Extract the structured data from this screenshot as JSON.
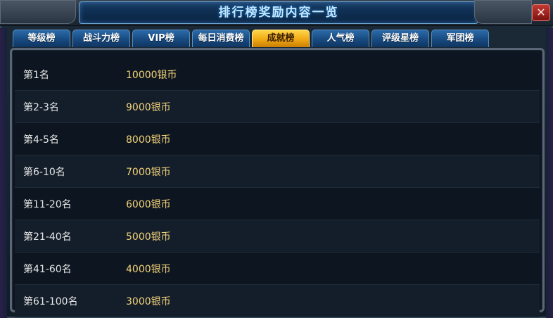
{
  "window": {
    "title": "排行榜奖励内容一览",
    "close_label": "✕"
  },
  "tabs": [
    {
      "label": "等级榜"
    },
    {
      "label": "战斗力榜"
    },
    {
      "label": "VIP榜"
    },
    {
      "label": "每日消费榜"
    },
    {
      "label": "成就榜",
      "active": true
    },
    {
      "label": "人气榜"
    },
    {
      "label": "评级星榜"
    },
    {
      "label": "军团榜"
    }
  ],
  "rewards": [
    {
      "rank": "第1名",
      "reward": "10000银币"
    },
    {
      "rank": "第2-3名",
      "reward": "9000银币"
    },
    {
      "rank": "第4-5名",
      "reward": "8000银币"
    },
    {
      "rank": "第6-10名",
      "reward": "7000银币"
    },
    {
      "rank": "第11-20名",
      "reward": "6000银币"
    },
    {
      "rank": "第21-40名",
      "reward": "5000银币"
    },
    {
      "rank": "第41-60名",
      "reward": "4000银币"
    },
    {
      "rank": "第61-100名",
      "reward": "3000银币"
    }
  ],
  "colors": {
    "tab_active": "#f0a913",
    "tab_inactive": "#174a80",
    "reward_text": "#f3d27a",
    "title_text": "#bfe6ff"
  }
}
